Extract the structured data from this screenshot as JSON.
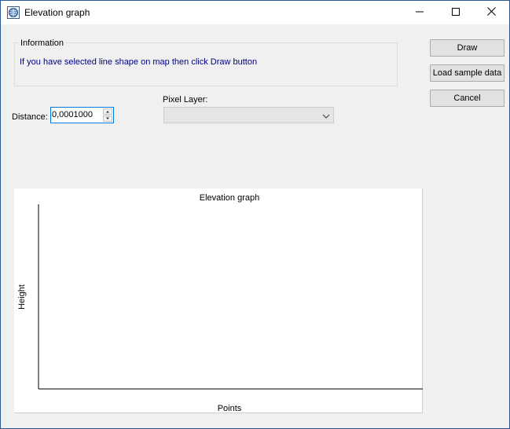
{
  "window": {
    "title": "Elevation graph",
    "controls": {
      "minimize": "minimize-icon",
      "maximize": "maximize-icon",
      "close": "close-icon"
    }
  },
  "information": {
    "legend": "Information",
    "text": "If you have selected line shape on map then click Draw button",
    "text_color": "#000080"
  },
  "buttons": {
    "draw": "Draw",
    "load_sample": "Load sample data",
    "cancel": "Cancel"
  },
  "distance": {
    "label": "Distance:",
    "value": "0,0001000"
  },
  "pixel_layer": {
    "label": "Pixel Layer:",
    "selected": ""
  },
  "chart_data": {
    "type": "line",
    "title": "Elevation graph",
    "xlabel": "Points",
    "ylabel": "Height",
    "series": [],
    "grid": false
  }
}
